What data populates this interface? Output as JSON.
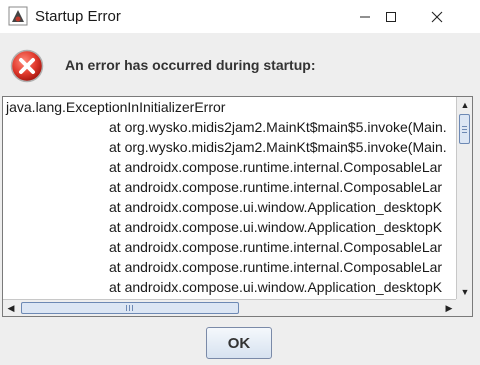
{
  "window": {
    "title": "Startup Error",
    "controls": [
      "minimize",
      "maximize",
      "close"
    ]
  },
  "dialog": {
    "icon": "error-icon",
    "message": "An error has occurred during startup:"
  },
  "stacktrace": {
    "lines": [
      "java.lang.ExceptionInInitializerError",
      "at org.wysko.midis2jam2.MainKt$main$5.invoke(Main.",
      "at org.wysko.midis2jam2.MainKt$main$5.invoke(Main.",
      "at androidx.compose.runtime.internal.ComposableLar",
      "at androidx.compose.runtime.internal.ComposableLar",
      "at androidx.compose.ui.window.Application_desktopK",
      "at androidx.compose.ui.window.Application_desktopK",
      "at androidx.compose.runtime.internal.ComposableLar",
      "at androidx.compose.runtime.internal.ComposableLar",
      "at androidx.compose.ui.window.Application_desktopK"
    ]
  },
  "buttons": {
    "ok_label": "OK"
  }
}
